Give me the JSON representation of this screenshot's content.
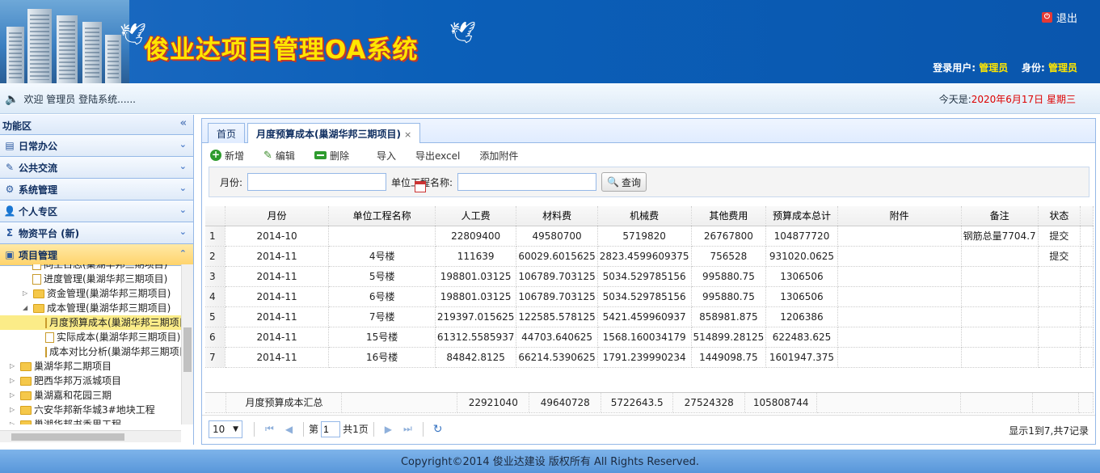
{
  "header": {
    "title": "俊业达项目管理OA系统",
    "logout_label": "退出",
    "login_user_label": "登录用户:",
    "login_user_value": "管理员",
    "role_label": "身份:",
    "role_value": "管理员"
  },
  "welcome": {
    "text": "欢迎 管理员 登陆系统......",
    "today_label": "今天是:",
    "today_value": "2020年6月17日 星期三"
  },
  "sidebar": {
    "title": "功能区",
    "sections": [
      {
        "label": "日常办公",
        "icon": "calendar-icon"
      },
      {
        "label": "公共交流",
        "icon": "pencil-icon"
      },
      {
        "label": "系统管理",
        "icon": "gears-icon"
      },
      {
        "label": "个人专区",
        "icon": "user-icon"
      },
      {
        "label": "物资平台 (新)",
        "icon": "sigma-icon"
      },
      {
        "label": "项目管理",
        "icon": "book-icon"
      }
    ],
    "tree": [
      "同工日志(巢湖华邦三期项目)",
      "进度管理(巢湖华邦三期项目)",
      "资金管理(巢湖华邦三期项目)",
      "成本管理(巢湖华邦三期项目)",
      "月度预算成本(巢湖华邦三期项目)",
      "实际成本(巢湖华邦三期项目)",
      "成本对比分析(巢湖华邦三期项目)",
      "巢湖华邦二期项目",
      "肥西华邦万派城项目",
      "巢湖嘉和花园三期",
      "六安华邦新华城3#地块工程",
      "巢湖华邦书香里工程"
    ]
  },
  "tabs": [
    {
      "label": "首页"
    },
    {
      "label": "月度预算成本(巢湖华邦三期项目)",
      "close": "×"
    }
  ],
  "toolbar": {
    "add": "新增",
    "edit": "编辑",
    "delete": "删除",
    "import": "导入",
    "export": "导出excel",
    "attach": "添加附件"
  },
  "search": {
    "month_label": "月份:",
    "month_value": "",
    "unit_label": "单位工程名称:",
    "unit_value": "",
    "query_label": "查询"
  },
  "grid": {
    "columns": [
      "月份",
      "单位工程名称",
      "人工费",
      "材料费",
      "机械费",
      "其他费用",
      "预算成本总计",
      "附件",
      "备注",
      "状态"
    ],
    "rows": [
      {
        "n": "1",
        "month": "2014-10",
        "unit": "",
        "labor": "22809400",
        "material": "49580700",
        "machine": "5719820",
        "other": "26767800",
        "total": "104877720",
        "attach": "",
        "remark": "钢筋总量7704.7",
        "status": "提交"
      },
      {
        "n": "2",
        "month": "2014-11",
        "unit": "4号楼",
        "labor": "111639",
        "material": "60029.6015625",
        "machine": "2823.4599609375",
        "other": "756528",
        "total": "931020.0625",
        "attach": "",
        "remark": "",
        "status": "提交"
      },
      {
        "n": "3",
        "month": "2014-11",
        "unit": "5号楼",
        "labor": "198801.03125",
        "material": "106789.703125",
        "machine": "5034.529785156",
        "other": "995880.75",
        "total": "1306506",
        "attach": "",
        "remark": "",
        "status": ""
      },
      {
        "n": "4",
        "month": "2014-11",
        "unit": "6号楼",
        "labor": "198801.03125",
        "material": "106789.703125",
        "machine": "5034.529785156",
        "other": "995880.75",
        "total": "1306506",
        "attach": "",
        "remark": "",
        "status": ""
      },
      {
        "n": "5",
        "month": "2014-11",
        "unit": "7号楼",
        "labor": "219397.015625",
        "material": "122585.578125",
        "machine": "5421.459960937",
        "other": "858981.875",
        "total": "1206386",
        "attach": "",
        "remark": "",
        "status": ""
      },
      {
        "n": "6",
        "month": "2014-11",
        "unit": "15号楼",
        "labor": "61312.5585937",
        "material": "44703.640625",
        "machine": "1568.160034179",
        "other": "514899.28125",
        "total": "622483.625",
        "attach": "",
        "remark": "",
        "status": ""
      },
      {
        "n": "7",
        "month": "2014-11",
        "unit": "16号楼",
        "labor": "84842.8125",
        "material": "66214.5390625",
        "machine": "1791.239990234",
        "other": "1449098.75",
        "total": "1601947.375",
        "attach": "",
        "remark": "",
        "status": ""
      }
    ],
    "summary": {
      "label": "月度预算成本汇总",
      "labor": "22921040",
      "material": "49640728",
      "machine": "5722643.5",
      "other": "27524328",
      "total": "105808744"
    }
  },
  "pager": {
    "page_size": "10",
    "page_prefix": "第",
    "page_value": "1",
    "page_total": "共1页",
    "record_info": "显示1到7,共7记录"
  },
  "footer": {
    "copyright": "Copyright©2014 俊业达建设 版权所有 All Rights Reserved."
  }
}
